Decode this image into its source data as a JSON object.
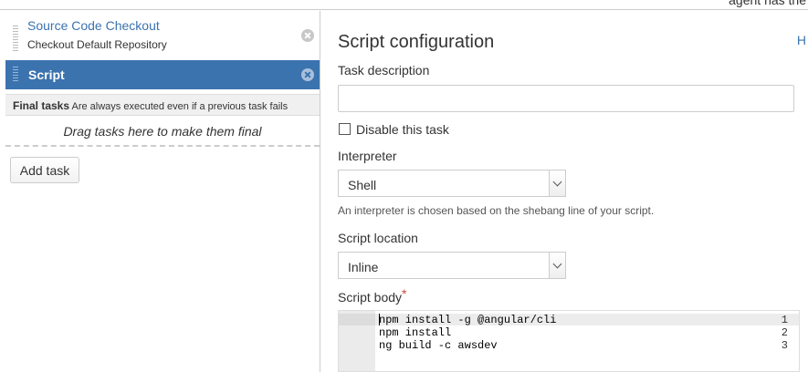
{
  "top_bar": {
    "partial_text": "agent has the"
  },
  "tasks": [
    {
      "title": "Source Code Checkout",
      "subtitle": "Checkout Default Repository"
    },
    {
      "title": "Script"
    }
  ],
  "final_tasks": {
    "label": "Final tasks",
    "description": "Are always executed even if a previous task fails",
    "drop_hint": "Drag tasks here to make them final"
  },
  "add_task_label": "Add task",
  "config": {
    "title": "Script configuration",
    "help_link": "H",
    "task_description_label": "Task description",
    "task_description_value": "",
    "disable_label": "Disable this task",
    "disable_checked": false,
    "interpreter_label": "Interpreter",
    "interpreter_value": "Shell",
    "interpreter_hint": "An interpreter is chosen based on the shebang line of your script.",
    "location_label": "Script location",
    "location_value": "Inline",
    "body_label": "Script body",
    "required_mark": "*",
    "script_lines": [
      {
        "num": "1",
        "code": "npm install -g @angular/cli"
      },
      {
        "num": "2",
        "code": "npm install"
      },
      {
        "num": "3",
        "code": "ng build -c awsdev"
      }
    ]
  },
  "colors": {
    "accent": "#3b73af",
    "required": "#d04437"
  }
}
